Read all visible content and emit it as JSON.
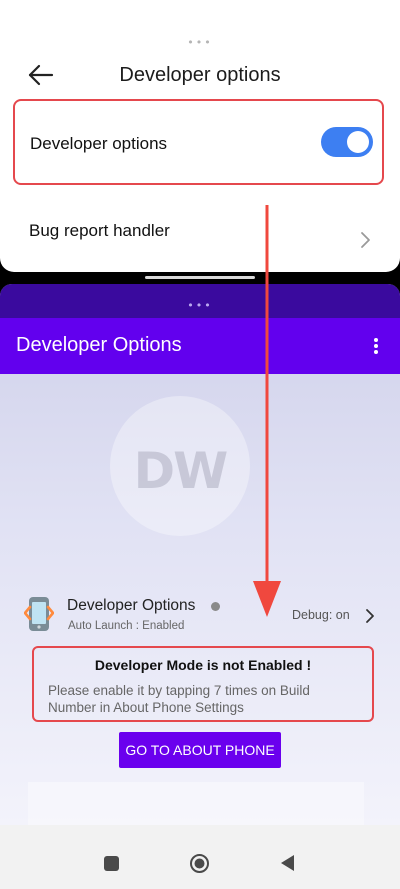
{
  "top_window": {
    "title": "Developer options",
    "handle": "•••",
    "developer_options_row": {
      "label": "Developer options",
      "toggle_on": true,
      "toggle_color": "#3d7ff2"
    },
    "bug_report_row": {
      "label": "Bug report handler"
    }
  },
  "bottom_window": {
    "handle": "•••",
    "app_bar": {
      "title": "Developer Options",
      "color": "#6200ee",
      "menu_icon": "kebab-menu-icon"
    },
    "watermark": {
      "text": "DW"
    },
    "app_row": {
      "icon": "developer-options-app-icon",
      "name": "Developer Options",
      "status_dot": "grey-status-dot",
      "subtitle": "Auto Launch : Enabled",
      "debug_status": "Debug: on"
    },
    "warning": {
      "title": "Developer Mode is not Enabled !",
      "message": "Please enable it by tapping 7 times on Build Number in About Phone Settings"
    },
    "about_button": {
      "label": "GO TO ABOUT PHONE",
      "color": "#6a00ee"
    }
  },
  "annotation": {
    "highlight_color": "#e5484d",
    "arrow_color": "#f0483e"
  },
  "nav_bar": {
    "recent_icon": "square-recents-icon",
    "home_icon": "circle-home-icon",
    "back_icon": "triangle-back-icon"
  }
}
